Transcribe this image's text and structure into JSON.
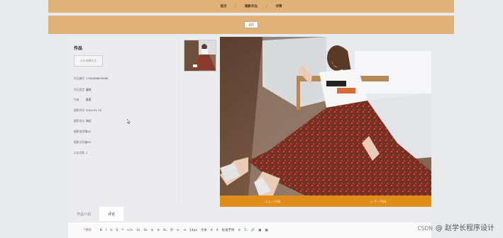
{
  "nav": {
    "home": "首页",
    "sep1": "/",
    "works": "摄影作品",
    "sep2": "/",
    "detail": "详情"
  },
  "subbar": {
    "back_label": "返回"
  },
  "info": {
    "title": "作品",
    "fav_label": "点击收藏作品",
    "rows": [
      {
        "label": "作品编号",
        "value": "1706406633989"
      },
      {
        "label": "作品类型",
        "value": "童装"
      },
      {
        "label": "作者",
        "value": "麦麦"
      },
      {
        "label": "摄影时间",
        "value": "2024-01-15"
      },
      {
        "label": "摄影地点",
        "value": "海边"
      },
      {
        "label": "摄影使用率",
        "value": "222"
      },
      {
        "label": "摄影浏览量",
        "value": "232"
      },
      {
        "label": "点击次数",
        "value": "1"
      }
    ]
  },
  "controls": {
    "prev": "◁ 上一下(0)",
    "next": "▷ 下一下(0)"
  },
  "tabs": [
    {
      "label": "作品介绍"
    },
    {
      "label": "评论"
    }
  ],
  "editor": {
    "required_mark": "*",
    "label": "评论",
    "tools": [
      "B",
      "I",
      "U",
      "S",
      "❝",
      "</>",
      "H₁",
      "H₂",
      "≡",
      "≡",
      "X₂",
      "X²",
      "⇤",
      "⇥",
      "14px",
      "文本",
      "A",
      "A",
      "标准字体",
      "≡",
      "Tₓ",
      "🔗",
      "▣",
      "▦"
    ]
  },
  "watermark": {
    "platform": "CSDN",
    "author": "@ 赵学长程序设计"
  },
  "colors": {
    "top_bar": "#e0b27a",
    "control_bar": "#e08e1a",
    "background": "#e9eaec"
  }
}
